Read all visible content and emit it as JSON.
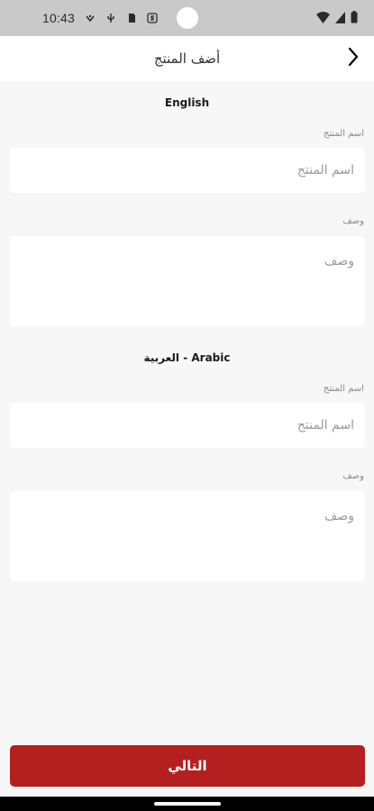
{
  "status_bar": {
    "time": "10:43",
    "left_icons": [
      "wifi-calling-icon",
      "usb-icon",
      "sim-card-icon",
      "app-s-icon"
    ],
    "right_icons": [
      "wifi-icon",
      "signal-icon",
      "battery-icon"
    ]
  },
  "app_bar": {
    "title": "أضف المنتج",
    "back_icon": "chevron-right-icon"
  },
  "english_section": {
    "title": "English",
    "name_label": "اسم المنتج",
    "name_placeholder": "اسم المنتج",
    "desc_label": "وصف",
    "desc_placeholder": "وصف"
  },
  "arabic_section": {
    "title": "العربية - Arabic",
    "name_label": "اسم المنتج",
    "name_placeholder": "اسم المنتج",
    "desc_label": "وصف",
    "desc_placeholder": "وصف"
  },
  "actions": {
    "next_label": "التالي"
  },
  "colors": {
    "primary": "#b3201f",
    "background": "#f7f7f7",
    "status_bar": "#c9c9c9"
  }
}
